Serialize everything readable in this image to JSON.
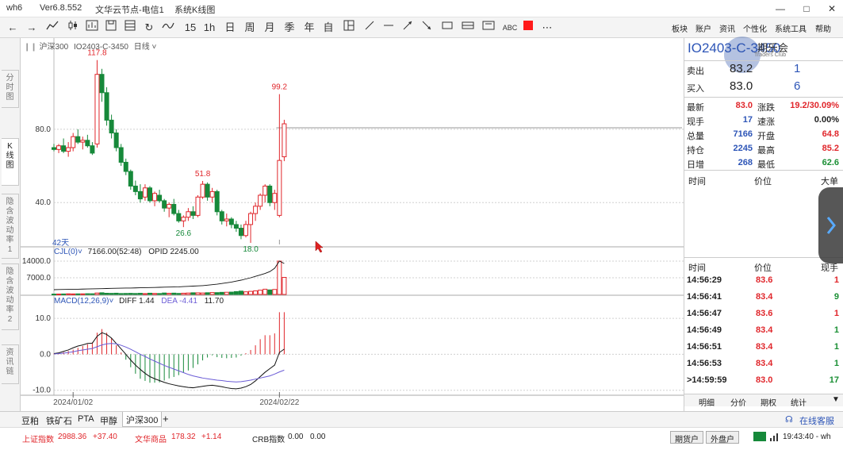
{
  "window": {
    "app": "wh6",
    "version": "Ver6.8.552",
    "node": "文华云节点-电信1",
    "module": "系统K线图"
  },
  "toolbar": {
    "icons": [
      "back-arrow-icon",
      "forward-arrow-icon",
      "line-chart-icon",
      "candlestick-icon",
      "bar-icon",
      "refresh-icon",
      "grid-icon",
      "indicator-icon"
    ],
    "periods": [
      "15",
      "1h",
      "日",
      "周",
      "月",
      "季",
      "年",
      "自"
    ],
    "draw_labels": {
      "abc": "ABC"
    },
    "right_menu": [
      "板块",
      "账户",
      "资讯",
      "个性化",
      "系统工具",
      "帮助"
    ]
  },
  "left_tabs": [
    {
      "label": "分\n时\n图",
      "active": false
    },
    {
      "label": "K\n线\n图",
      "active": true
    },
    {
      "label": "隐\n含\n波\n动\n率\n1",
      "active": false
    },
    {
      "label": "隐\n含\n波\n动\n率\n2",
      "active": false
    },
    {
      "label": "资\n讯\n链",
      "active": false
    }
  ],
  "chart_header": {
    "index": "沪深300",
    "contract": "IO2403-C-3450",
    "period": "日线"
  },
  "chart_data": [
    {
      "type": "candlestick",
      "ylim": [
        18,
        122
      ],
      "yticks": [
        40.0,
        80.0
      ],
      "annotations": [
        {
          "label": "117.8",
          "index": 9,
          "value": 117.8,
          "kind": "high"
        },
        {
          "label": "26.6",
          "index": 27,
          "value": 26.6,
          "kind": "low"
        },
        {
          "label": "51.8",
          "index": 31,
          "value": 51.8,
          "kind": "high"
        },
        {
          "label": "18.0",
          "index": 41,
          "value": 18.0,
          "kind": "low"
        },
        {
          "label": "99.2",
          "index": 47,
          "value": 99.2,
          "kind": "high"
        }
      ],
      "days_label": "42天",
      "candles": [
        {
          "o": 70,
          "h": 72,
          "l": 68,
          "c": 69
        },
        {
          "o": 69,
          "h": 72,
          "l": 67,
          "c": 71
        },
        {
          "o": 71,
          "h": 75,
          "l": 67,
          "c": 68
        },
        {
          "o": 68,
          "h": 73,
          "l": 65,
          "c": 70
        },
        {
          "o": 70,
          "h": 78,
          "l": 68,
          "c": 76
        },
        {
          "o": 76,
          "h": 80,
          "l": 72,
          "c": 73
        },
        {
          "o": 73,
          "h": 76,
          "l": 69,
          "c": 74
        },
        {
          "o": 74,
          "h": 77,
          "l": 70,
          "c": 71
        },
        {
          "o": 71,
          "h": 73,
          "l": 66,
          "c": 67
        },
        {
          "o": 72,
          "h": 117.8,
          "l": 70,
          "c": 110
        },
        {
          "o": 110,
          "h": 113,
          "l": 95,
          "c": 100
        },
        {
          "o": 100,
          "h": 103,
          "l": 82,
          "c": 85
        },
        {
          "o": 85,
          "h": 88,
          "l": 75,
          "c": 78
        },
        {
          "o": 78,
          "h": 80,
          "l": 68,
          "c": 70
        },
        {
          "o": 70,
          "h": 72,
          "l": 60,
          "c": 62
        },
        {
          "o": 62,
          "h": 64,
          "l": 55,
          "c": 57
        },
        {
          "o": 57,
          "h": 58,
          "l": 47,
          "c": 49
        },
        {
          "o": 49,
          "h": 52,
          "l": 44,
          "c": 46
        },
        {
          "o": 46,
          "h": 50,
          "l": 40,
          "c": 42
        },
        {
          "o": 43,
          "h": 50,
          "l": 41,
          "c": 48
        },
        {
          "o": 48,
          "h": 49,
          "l": 40,
          "c": 41
        },
        {
          "o": 41,
          "h": 46,
          "l": 38,
          "c": 45
        },
        {
          "o": 44,
          "h": 47,
          "l": 40,
          "c": 41
        },
        {
          "o": 41,
          "h": 42,
          "l": 35,
          "c": 37
        },
        {
          "o": 37,
          "h": 40,
          "l": 32,
          "c": 39
        },
        {
          "o": 39,
          "h": 42,
          "l": 33,
          "c": 34
        },
        {
          "o": 34,
          "h": 36,
          "l": 29,
          "c": 30
        },
        {
          "o": 30,
          "h": 33,
          "l": 26.6,
          "c": 32
        },
        {
          "o": 32,
          "h": 37,
          "l": 30,
          "c": 35
        },
        {
          "o": 35,
          "h": 38,
          "l": 31,
          "c": 33
        },
        {
          "o": 33,
          "h": 44,
          "l": 32,
          "c": 43
        },
        {
          "o": 43,
          "h": 51.8,
          "l": 42,
          "c": 50
        },
        {
          "o": 50,
          "h": 51,
          "l": 41,
          "c": 43
        },
        {
          "o": 43,
          "h": 48,
          "l": 40,
          "c": 46
        },
        {
          "o": 46,
          "h": 47,
          "l": 33,
          "c": 35
        },
        {
          "o": 35,
          "h": 36,
          "l": 28,
          "c": 30
        },
        {
          "o": 30,
          "h": 34,
          "l": 27,
          "c": 31
        },
        {
          "o": 31,
          "h": 32,
          "l": 26,
          "c": 28
        },
        {
          "o": 28,
          "h": 30,
          "l": 24,
          "c": 26
        },
        {
          "o": 26,
          "h": 28,
          "l": 20,
          "c": 22
        },
        {
          "o": 22,
          "h": 30,
          "l": 21,
          "c": 28
        },
        {
          "o": 28,
          "h": 35,
          "l": 18,
          "c": 34
        },
        {
          "o": 34,
          "h": 40,
          "l": 30,
          "c": 38
        },
        {
          "o": 38,
          "h": 45,
          "l": 36,
          "c": 44
        },
        {
          "o": 44,
          "h": 50,
          "l": 40,
          "c": 49
        },
        {
          "o": 49,
          "h": 50,
          "l": 38,
          "c": 40
        },
        {
          "o": 40,
          "h": 47,
          "l": 36,
          "c": 45
        },
        {
          "o": 33,
          "h": 99.2,
          "l": 32,
          "c": 63
        },
        {
          "o": 65,
          "h": 85.2,
          "l": 62.6,
          "c": 83
        }
      ]
    },
    {
      "type": "bar",
      "indicator": "CJL(0)",
      "readout": "7166.00(52:48)",
      "opid_readout": "OPID 2245.00",
      "yticks": [
        7000.0,
        14000.0
      ],
      "ylim": [
        0,
        15000
      ],
      "values": [
        150,
        180,
        200,
        260,
        220,
        240,
        250,
        300,
        280,
        600,
        700,
        500,
        450,
        520,
        380,
        420,
        460,
        400,
        480,
        350,
        520,
        410,
        380,
        600,
        480,
        550,
        420,
        520,
        600,
        700,
        680,
        620,
        720,
        800,
        760,
        880,
        920,
        980,
        1200,
        1400,
        1100,
        1300,
        1500,
        1800,
        2200,
        1900,
        2100,
        14000,
        7166
      ],
      "oi_line": [
        2000,
        2050,
        2100,
        2150,
        2200,
        2200,
        2250,
        2300,
        2350,
        2400,
        2450,
        2500,
        2550,
        2600,
        2650,
        2700,
        2700,
        2750,
        2800,
        2850,
        2900,
        2950,
        3000,
        3050,
        3100,
        3150,
        3200,
        3300,
        3400,
        3500,
        3600,
        3700,
        3900,
        4100,
        4300,
        4600,
        4900,
        5200,
        5600,
        6000,
        6500,
        7000,
        7600,
        8200,
        8800,
        9600,
        11000,
        14000,
        13000
      ]
    },
    {
      "type": "bar",
      "indicator": "MACD(12,26,9)",
      "diff_readout": "DIFF 1.44",
      "dea_readout": "DEA -4.41",
      "macd_readout": "11.70",
      "yticks": [
        -10.0,
        0.0,
        10.0
      ],
      "ylim": [
        -10.5,
        12
      ],
      "macd": [
        0.2,
        0.3,
        0.6,
        0.9,
        1.3,
        1.8,
        2.3,
        2.8,
        3.3,
        6.0,
        7.0,
        6.0,
        4.5,
        2.5,
        0.5,
        -1.5,
        -3.6,
        -5.4,
        -6.8,
        -7.4,
        -7.9,
        -7.9,
        -7.8,
        -7.3,
        -6.7,
        -6.3,
        -5.8,
        -5.2,
        -4.5,
        -3.8,
        -2.8,
        -1.7,
        -0.9,
        -0.3,
        -0.8,
        -1.0,
        -1.1,
        -1.0,
        -0.9,
        -0.4,
        0.3,
        1.2,
        2.5,
        4.2,
        5.3,
        5.3,
        5.8,
        11.7,
        11.7
      ],
      "diff": [
        0.2,
        0.4,
        0.8,
        1.2,
        1.8,
        2.3,
        2.6,
        3.0,
        3.1,
        5.0,
        6.0,
        5.5,
        4.5,
        3.0,
        1.5,
        0.0,
        -1.6,
        -3.0,
        -4.2,
        -5.3,
        -6.2,
        -6.8,
        -7.3,
        -7.8,
        -8.2,
        -8.5,
        -8.8,
        -9.0,
        -9.2,
        -9.3,
        -9.1,
        -8.9,
        -8.7,
        -8.6,
        -8.8,
        -9.0,
        -9.3,
        -9.5,
        -9.6,
        -9.4,
        -9.0,
        -8.4,
        -7.4,
        -6.2,
        -5.0,
        -4.0,
        -3.0,
        0.5,
        1.44
      ],
      "dea": [
        0.1,
        0.2,
        0.3,
        0.5,
        0.7,
        1.0,
        1.2,
        1.4,
        1.6,
        2.1,
        2.6,
        2.9,
        3.0,
        2.9,
        2.5,
        2.0,
        1.4,
        0.7,
        0.0,
        -0.6,
        -1.3,
        -1.9,
        -2.5,
        -3.1,
        -3.6,
        -4.1,
        -4.6,
        -5.1,
        -5.6,
        -6.0,
        -6.3,
        -6.6,
        -6.8,
        -7.0,
        -7.2,
        -7.3,
        -7.5,
        -7.6,
        -7.7,
        -7.6,
        -7.4,
        -7.2,
        -6.9,
        -6.6,
        -6.3,
        -6.0,
        -5.5,
        -4.9,
        -4.41
      ],
      "xticks": [
        {
          "label": "2024/01/02",
          "index": 4
        },
        {
          "label": "2024/02/22",
          "index": 47
        }
      ]
    }
  ],
  "quote": {
    "title": "IO2403-C-3450",
    "logo_text": "期乐会",
    "logo_sub": "Traders Club",
    "ask": {
      "label": "卖出",
      "price": "83.2",
      "vol": "1"
    },
    "bid": {
      "label": "买入",
      "price": "83.0",
      "vol": "6"
    },
    "fields": [
      {
        "l": "最新",
        "v": "83.0",
        "vc": "red",
        "l2": "涨跌",
        "v2": "19.2/30.09%",
        "v2c": "red"
      },
      {
        "l": "现手",
        "v": "17",
        "vc": "blue",
        "l2": "速涨",
        "v2": "0.00%",
        "v2c": "dark"
      },
      {
        "l": "总量",
        "v": "7166",
        "vc": "blue",
        "l2": "开盘",
        "v2": "64.8",
        "v2c": "red"
      },
      {
        "l": "持仓",
        "v": "2245",
        "vc": "blue",
        "l2": "最高",
        "v2": "85.2",
        "v2c": "red"
      },
      {
        "l": "日增",
        "v": "268",
        "vc": "blue",
        "l2": "最低",
        "v2": "62.6",
        "v2c": "green"
      }
    ],
    "bigorder_header": {
      "time": "时间",
      "price": "价位",
      "big": "大单"
    },
    "ticks_header": {
      "time": "时间",
      "price": "价位",
      "hand": "现手"
    },
    "ticks": [
      {
        "t": "14:56:29",
        "p": "83.6",
        "v": "1",
        "vc": "red"
      },
      {
        "t": "14:56:41",
        "p": "83.4",
        "v": "9",
        "vc": "green"
      },
      {
        "t": "14:56:47",
        "p": "83.6",
        "v": "1",
        "vc": "red"
      },
      {
        "t": "14:56:49",
        "p": "83.4",
        "v": "1",
        "vc": "green"
      },
      {
        "t": "14:56:51",
        "p": "83.4",
        "v": "1",
        "vc": "green"
      },
      {
        "t": "14:56:53",
        "p": "83.4",
        "v": "1",
        "vc": "green"
      },
      {
        "t": ">14:59:59",
        "p": "83.0",
        "v": "17",
        "vc": "green"
      }
    ],
    "bottom_tabs": [
      "明细",
      "分价",
      "期权",
      "统计"
    ]
  },
  "bottom_tabs": [
    "豆粕",
    "铁矿石",
    "PTA",
    "甲醇",
    "沪深300",
    "+"
  ],
  "service": "在线客服",
  "status": {
    "sh_label": "上证指数",
    "sh_value": "2988.36",
    "sh_change": "+37.40",
    "wh_label": "文华商品",
    "wh_value": "178.32",
    "wh_change": "+1.14",
    "crb_label": "CRB指数",
    "crb_value": "0.00",
    "crb_change": "0.00",
    "btn1": "期货户",
    "btn2": "外盘户",
    "time": "19:43:40 - wh"
  },
  "colors": {
    "up": "#e0262b",
    "down": "#16893a",
    "grid": "#d0d0d0",
    "diff": "#111111",
    "dea": "#6b5cd6"
  }
}
